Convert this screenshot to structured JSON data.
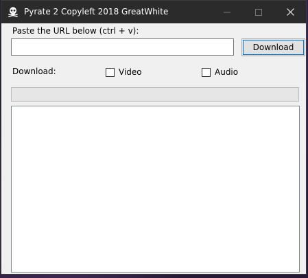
{
  "window": {
    "title": "Pyrate 2 Copyleft 2018 GreatWhite",
    "icon": "skull-crossbones-icon",
    "controls": {
      "minimize_icon": "minimize-icon",
      "maximize_icon": "maximize-icon",
      "close_icon": "close-icon"
    }
  },
  "url": {
    "label": "Paste the URL below (ctrl + v):",
    "value": "",
    "placeholder": ""
  },
  "download_button": {
    "label": "Download"
  },
  "options": {
    "label": "Download:",
    "video": {
      "label": "Video",
      "checked": false
    },
    "audio": {
      "label": "Audio",
      "checked": false
    }
  },
  "progress": {
    "value": 0
  },
  "log": {
    "value": ""
  },
  "colors": {
    "titlebar": "#2b2b2b",
    "window_bg": "#f0f0f0",
    "focus_accent": "#0078d7"
  }
}
